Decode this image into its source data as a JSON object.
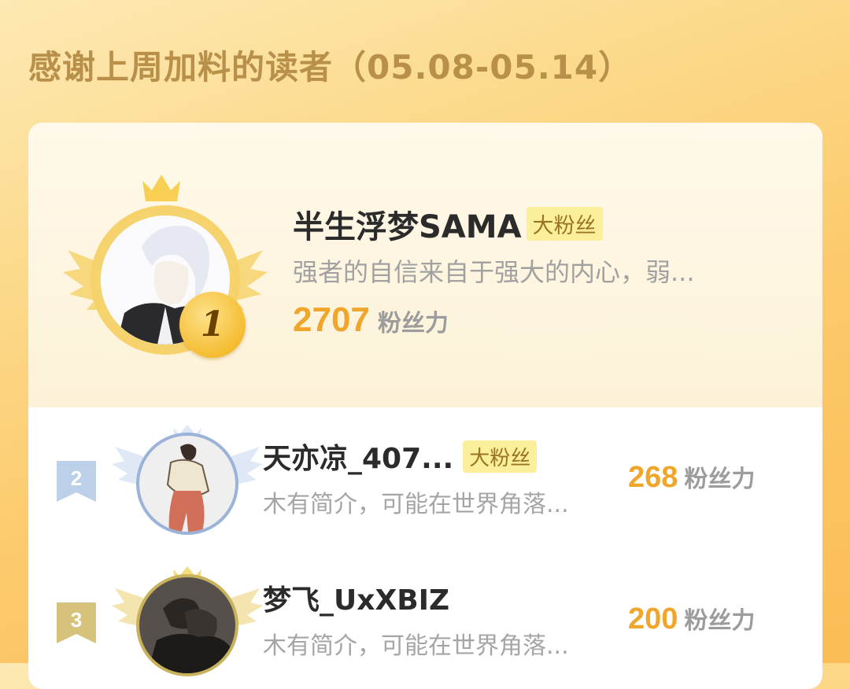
{
  "header": {
    "title": "感谢上周加料的读者（05.08-05.14）"
  },
  "top_reader": {
    "rank": "1",
    "name": "半生浮梦SAMA",
    "tag": "大粉丝",
    "bio": "强者的自信来自于强大的内心，弱...",
    "score": "2707",
    "score_unit": "粉丝力",
    "icons": [
      "crown-icon",
      "wings-icon"
    ]
  },
  "readers": [
    {
      "rank": "2",
      "name": "天亦凉_407...",
      "tag": "大粉丝",
      "bio": "木有简介，可能在世界角落...",
      "score": "268",
      "score_unit": "粉丝力"
    },
    {
      "rank": "3",
      "name": "梦飞_UxXBIZ",
      "tag": "",
      "bio": "木有简介，可能在世界角落...",
      "score": "200",
      "score_unit": "粉丝力"
    }
  ],
  "colors": {
    "background": "#fcd98a",
    "title": "#b8904a",
    "score": "#f0a62a",
    "tag_bg": "#fbef9c",
    "gold": "#f5bd32",
    "silver": "#b9cde6",
    "bronze": "#d8c47a"
  }
}
